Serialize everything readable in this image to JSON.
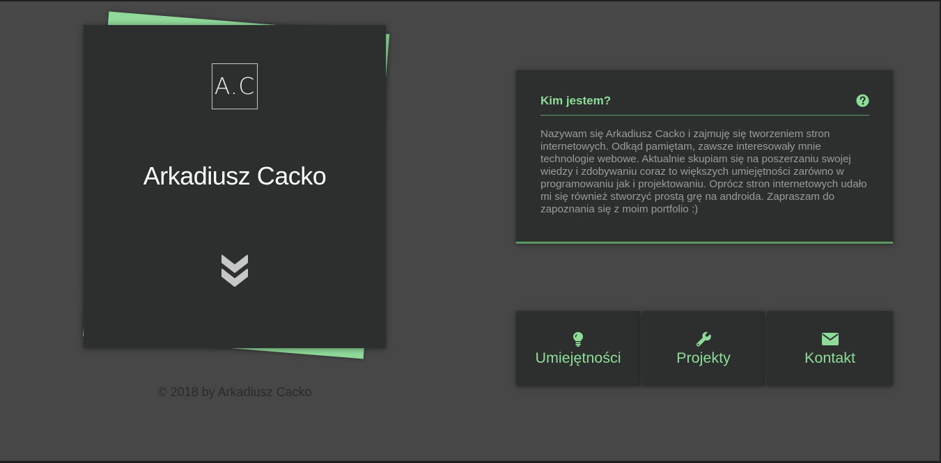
{
  "hero": {
    "logo_text": "A.C",
    "name": "Arkadiusz Cacko",
    "scroll_icon": "double-chevron-down-icon",
    "copyright": "© 2018 by Arkadiusz Cacko"
  },
  "about": {
    "title": "Kim jestem?",
    "icon": "question-circle-icon",
    "text": "Nazywam się Arkadiusz Cacko i zajmuję się tworzeniem stron internetowych. Odkąd pamiętam, zawsze interesowały mnie technologie webowe. Aktualnie skupiam się na poszerzaniu swojej wiedzy i zdobywaniu coraz to większych umiejętności zarówno w programowaniu jak i projektowaniu. Oprócz stron internetowych udało mi się również stworzyć prostą grę na androida. Zapraszam do zapoznania się z moim portfolio :)"
  },
  "nav": [
    {
      "label": "Umiejętności",
      "icon": "lightbulb-icon"
    },
    {
      "label": "Projekty",
      "icon": "wrench-icon"
    },
    {
      "label": "Kontakt",
      "icon": "envelope-icon"
    }
  ],
  "colors": {
    "accent": "#8fdc98",
    "card": "#2c2f2e",
    "background": "#464746"
  }
}
